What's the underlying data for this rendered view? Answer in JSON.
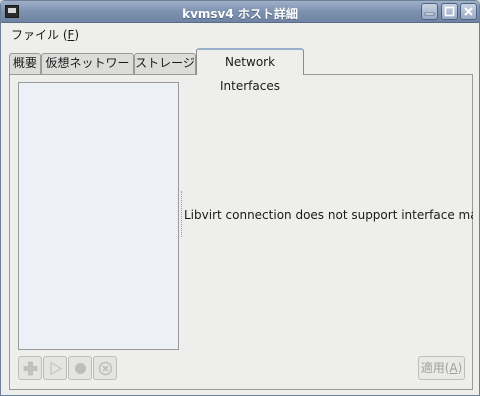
{
  "window": {
    "title": "kvmsv4 ホスト詳細"
  },
  "menubar": {
    "file_label": "ファイル (",
    "file_mnemonic": "F",
    "file_close": ")"
  },
  "tabs": [
    {
      "label": "概要"
    },
    {
      "label": "仮想ネットワーク"
    },
    {
      "label": "ストレージ"
    },
    {
      "label": "Network Interfaces"
    }
  ],
  "active_tab": "Network Interfaces",
  "interfaces_page": {
    "message": "Libvirt connection does not support interface management.",
    "apply_label": "適用(",
    "apply_mnemonic": "A",
    "apply_close": ")"
  },
  "icons": {
    "app": "terminal-icon",
    "minimize": "minimize-icon",
    "maximize": "maximize-icon",
    "close": "close-icon",
    "add": "add-icon",
    "start": "play-icon",
    "stop": "stop-icon",
    "delete": "delete-icon"
  },
  "colors": {
    "titlebar": "#7d91af",
    "list_background": "#edf1f7",
    "window_background": "#eeeeec",
    "active_tab_accent": "#9ab0cf"
  }
}
